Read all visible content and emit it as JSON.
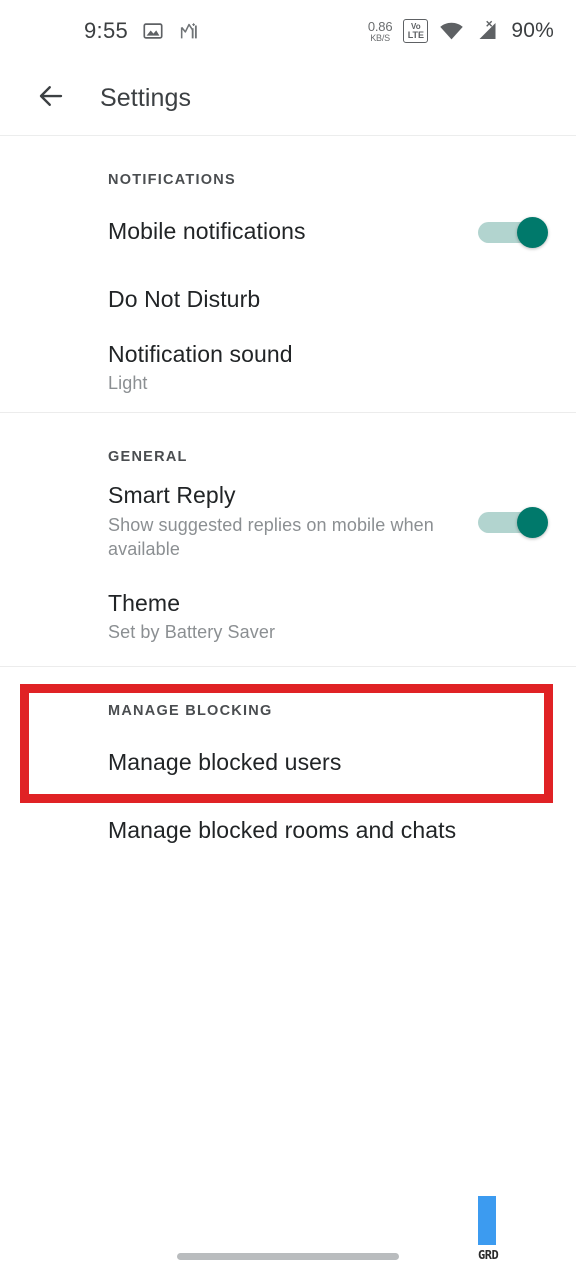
{
  "statusbar": {
    "time": "9:55",
    "icons_left": [
      "image-icon",
      "signal-chart-icon"
    ],
    "data_rate_value": "0.86",
    "data_rate_unit": "KB/S",
    "volte_top": "Vo",
    "volte_bottom": "LTE",
    "wifi_icon": "wifi-icon",
    "cellular_icon": "cellular-no-sim-icon",
    "battery": "90%"
  },
  "appbar": {
    "back_icon": "back-arrow-icon",
    "title": "Settings"
  },
  "sections": [
    {
      "header": "NOTIFICATIONS",
      "rows": [
        {
          "title": "Mobile notifications",
          "subtitle": "",
          "control": "switch",
          "switch_on": true
        },
        {
          "title": "Do Not Disturb",
          "subtitle": "",
          "control": "none"
        },
        {
          "title": "Notification sound",
          "subtitle": "Light",
          "control": "none"
        }
      ]
    },
    {
      "header": "GENERAL",
      "rows": [
        {
          "title": "Smart Reply",
          "subtitle": "Show suggested replies on mobile when available",
          "control": "switch",
          "switch_on": true
        },
        {
          "title": "Theme",
          "subtitle": "Set by Battery Saver",
          "control": "none",
          "highlighted": true
        }
      ]
    },
    {
      "header": "MANAGE BLOCKING",
      "rows": [
        {
          "title": "Manage blocked users",
          "subtitle": "",
          "control": "none"
        },
        {
          "title": "Manage blocked rooms and chats",
          "subtitle": "",
          "control": "none"
        }
      ]
    }
  ],
  "annotation": {
    "type": "highlight-rectangle",
    "color": "#e02225",
    "target": "Theme"
  },
  "watermark": {
    "text": "GRD",
    "color": "#3c9bf0"
  },
  "navigation": {
    "pill": "gesture-home-pill"
  },
  "colors": {
    "accent_switch": "#00796b",
    "switch_track": "#b2d4cf",
    "title_text": "#212426",
    "subtitle_text": "#8b8f92",
    "annotation_red": "#e02225",
    "watermark_blue": "#3c9bf0"
  }
}
